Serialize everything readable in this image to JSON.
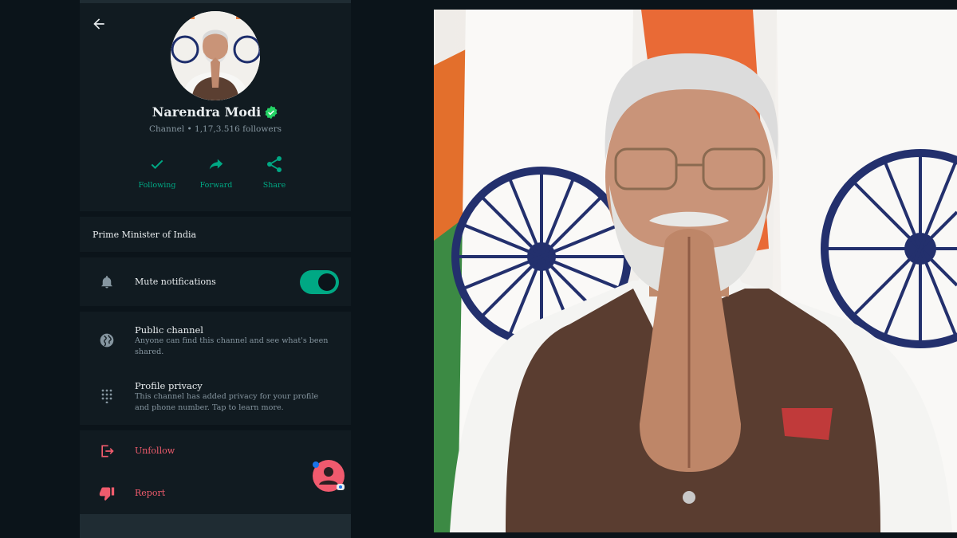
{
  "channel": {
    "name": "Narendra Modi",
    "meta": "Channel • 1,17,3.516 followers",
    "description": "Prime Minister of India"
  },
  "actions": [
    {
      "label": "Following",
      "icon": "check-icon"
    },
    {
      "label": "Forward",
      "icon": "forward-icon"
    },
    {
      "label": "Share",
      "icon": "share-icon"
    }
  ],
  "settings": {
    "mute": {
      "label": "Mute notifications",
      "enabled": true,
      "icon": "bell-icon"
    },
    "public_channel": {
      "title": "Public channel",
      "subtitle": "Anyone can find this channel and see what's been shared.",
      "icon": "globe-icon"
    },
    "profile_privacy": {
      "title": "Profile privacy",
      "subtitle": "This channel has added privacy for your profile and phone number. Tap to learn more.",
      "icon": "dots-grid-icon"
    }
  },
  "danger": {
    "unfollow": "Unfollow",
    "report": "Report"
  },
  "colors": {
    "accent": "#00a884",
    "danger": "#f15c6d",
    "background": "#111b21"
  }
}
